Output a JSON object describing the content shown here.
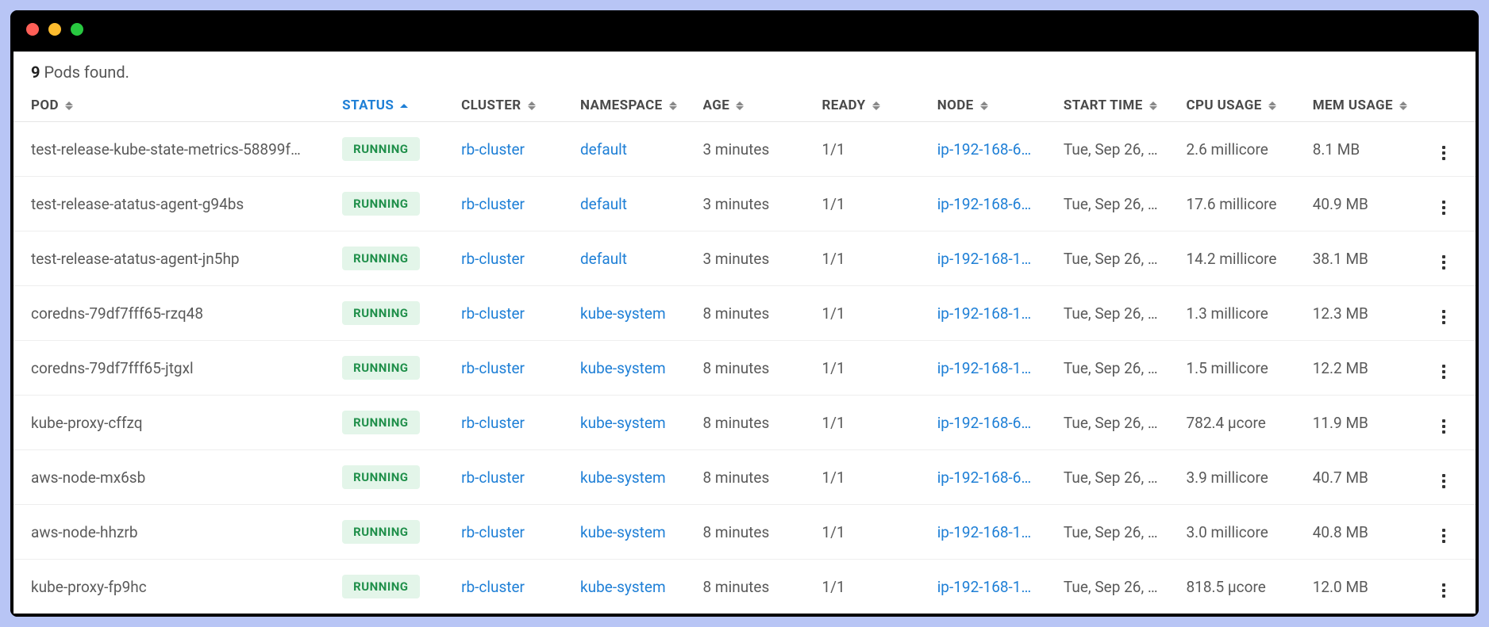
{
  "summary": {
    "count": "9",
    "text": " Pods found."
  },
  "columns": {
    "pod": "POD",
    "status": "STATUS",
    "cluster": "CLUSTER",
    "namespace": "NAMESPACE",
    "age": "AGE",
    "ready": "READY",
    "node": "NODE",
    "start": "START TIME",
    "cpu": "CPU USAGE",
    "mem": "MEM USAGE"
  },
  "sort": {
    "column": "status",
    "direction": "asc"
  },
  "rows": [
    {
      "pod": "test-release-kube-state-metrics-58899f…",
      "status": "RUNNING",
      "cluster": "rb-cluster",
      "namespace": "default",
      "age": "3 minutes",
      "ready": "1/1",
      "node": "ip-192-168-6…",
      "start": "Tue, Sep 26, …",
      "cpu": "2.6 millicore",
      "mem": "8.1 MB"
    },
    {
      "pod": "test-release-atatus-agent-g94bs",
      "status": "RUNNING",
      "cluster": "rb-cluster",
      "namespace": "default",
      "age": "3 minutes",
      "ready": "1/1",
      "node": "ip-192-168-6…",
      "start": "Tue, Sep 26, …",
      "cpu": "17.6 millicore",
      "mem": "40.9 MB"
    },
    {
      "pod": "test-release-atatus-agent-jn5hp",
      "status": "RUNNING",
      "cluster": "rb-cluster",
      "namespace": "default",
      "age": "3 minutes",
      "ready": "1/1",
      "node": "ip-192-168-1…",
      "start": "Tue, Sep 26, …",
      "cpu": "14.2 millicore",
      "mem": "38.1 MB"
    },
    {
      "pod": "coredns-79df7fff65-rzq48",
      "status": "RUNNING",
      "cluster": "rb-cluster",
      "namespace": "kube-system",
      "age": "8 minutes",
      "ready": "1/1",
      "node": "ip-192-168-1…",
      "start": "Tue, Sep 26, …",
      "cpu": "1.3 millicore",
      "mem": "12.3 MB"
    },
    {
      "pod": "coredns-79df7fff65-jtgxl",
      "status": "RUNNING",
      "cluster": "rb-cluster",
      "namespace": "kube-system",
      "age": "8 minutes",
      "ready": "1/1",
      "node": "ip-192-168-1…",
      "start": "Tue, Sep 26, …",
      "cpu": "1.5 millicore",
      "mem": "12.2 MB"
    },
    {
      "pod": "kube-proxy-cffzq",
      "status": "RUNNING",
      "cluster": "rb-cluster",
      "namespace": "kube-system",
      "age": "8 minutes",
      "ready": "1/1",
      "node": "ip-192-168-6…",
      "start": "Tue, Sep 26, …",
      "cpu": "782.4 μcore",
      "mem": "11.9 MB"
    },
    {
      "pod": "aws-node-mx6sb",
      "status": "RUNNING",
      "cluster": "rb-cluster",
      "namespace": "kube-system",
      "age": "8 minutes",
      "ready": "1/1",
      "node": "ip-192-168-6…",
      "start": "Tue, Sep 26, …",
      "cpu": "3.9 millicore",
      "mem": "40.7 MB"
    },
    {
      "pod": "aws-node-hhzrb",
      "status": "RUNNING",
      "cluster": "rb-cluster",
      "namespace": "kube-system",
      "age": "8 minutes",
      "ready": "1/1",
      "node": "ip-192-168-1…",
      "start": "Tue, Sep 26, …",
      "cpu": "3.0 millicore",
      "mem": "40.8 MB"
    },
    {
      "pod": "kube-proxy-fp9hc",
      "status": "RUNNING",
      "cluster": "rb-cluster",
      "namespace": "kube-system",
      "age": "8 minutes",
      "ready": "1/1",
      "node": "ip-192-168-1…",
      "start": "Tue, Sep 26, …",
      "cpu": "818.5 μcore",
      "mem": "12.0 MB"
    }
  ]
}
